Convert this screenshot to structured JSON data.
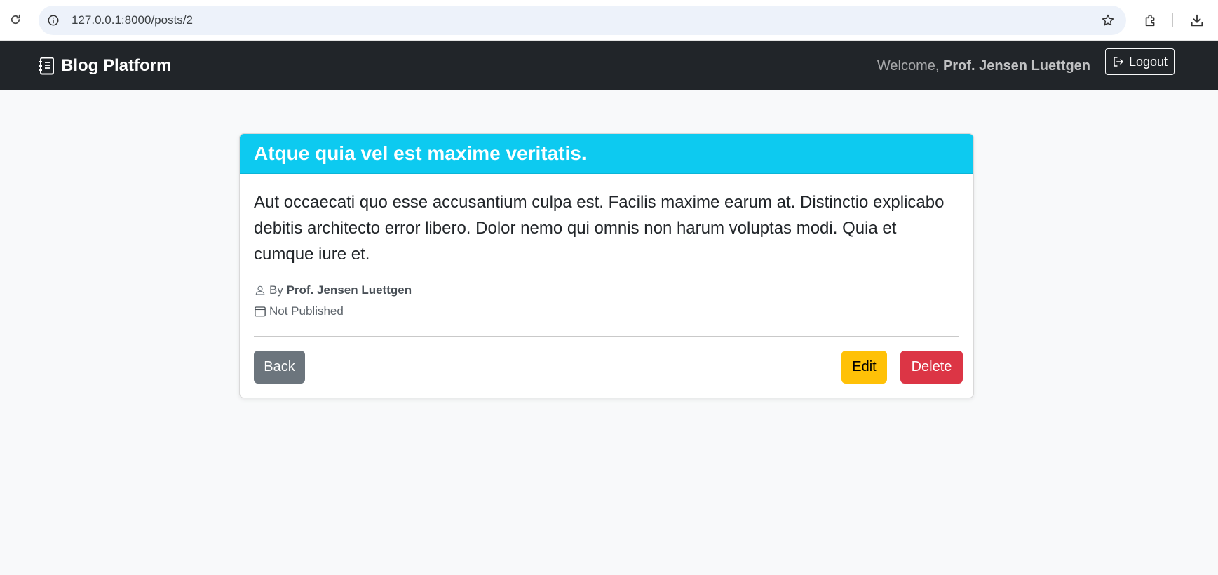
{
  "browser": {
    "url": "127.0.0.1:8000/posts/2",
    "icons": [
      "reload-icon",
      "site-info-icon",
      "bookmark-star-icon",
      "extensions-icon",
      "download-icon"
    ]
  },
  "navbar": {
    "brand": "Blog Platform",
    "welcome_prefix": "Welcome, ",
    "user_name": "Prof. Jensen Luettgen",
    "logout_label": "Logout"
  },
  "post": {
    "title": "Atque quia vel est maxime veritatis.",
    "content": "Aut occaecati quo esse accusantium culpa est. Facilis maxime earum at. Distinctio explicabo debitis architecto error libero. Dolor nemo qui omnis non harum voluptas modi. Quia et cumque iure et.",
    "by_label": "By ",
    "author": "Prof. Jensen Luettgen",
    "status": "Not Published"
  },
  "actions": {
    "back_label": "Back",
    "edit_label": "Edit",
    "delete_label": "Delete"
  },
  "colors": {
    "navbar_bg": "#212529",
    "card_header_bg": "#0dcaf0",
    "back_button": "#6c757d",
    "edit_button": "#ffc107",
    "delete_button": "#dc3545",
    "page_bg": "#f8f9fa"
  }
}
